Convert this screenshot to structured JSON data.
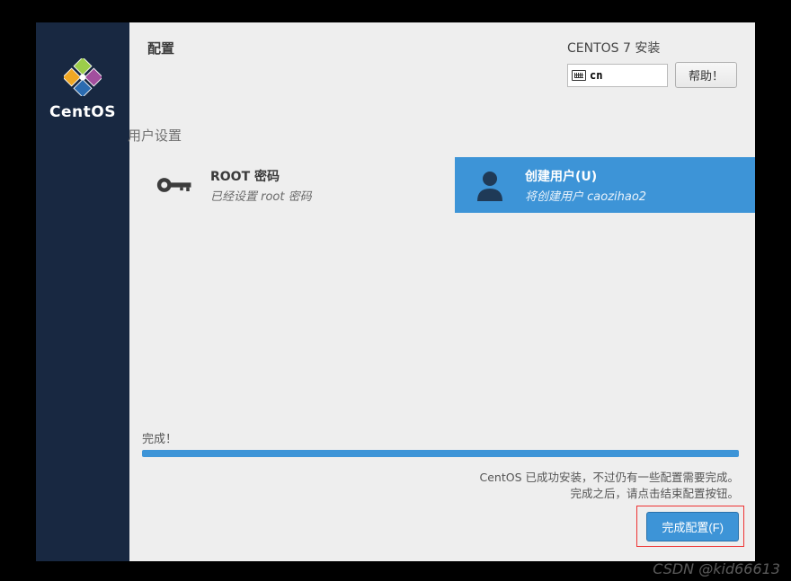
{
  "header": {
    "left_title": "配置",
    "install_title": "CENTOS 7 安装",
    "lang_code": "cn",
    "help_label": "帮助！"
  },
  "sidebar": {
    "brand": "CentOS"
  },
  "section": {
    "title": "用户设置"
  },
  "cards": {
    "root": {
      "title": "ROOT 密码",
      "subtitle": "已经设置 root 密码"
    },
    "user": {
      "title": "创建用户(U)",
      "subtitle": "将创建用户 caozihao2"
    }
  },
  "progress": {
    "label": "完成！",
    "percent": 100
  },
  "finish": {
    "msg_line1": "CentOS 已成功安装，不过仍有一些配置需要完成。",
    "msg_line2": "完成之后，请点击结束配置按钮。",
    "button_label": "完成配置(F)"
  },
  "watermark": "CSDN @kid66613"
}
